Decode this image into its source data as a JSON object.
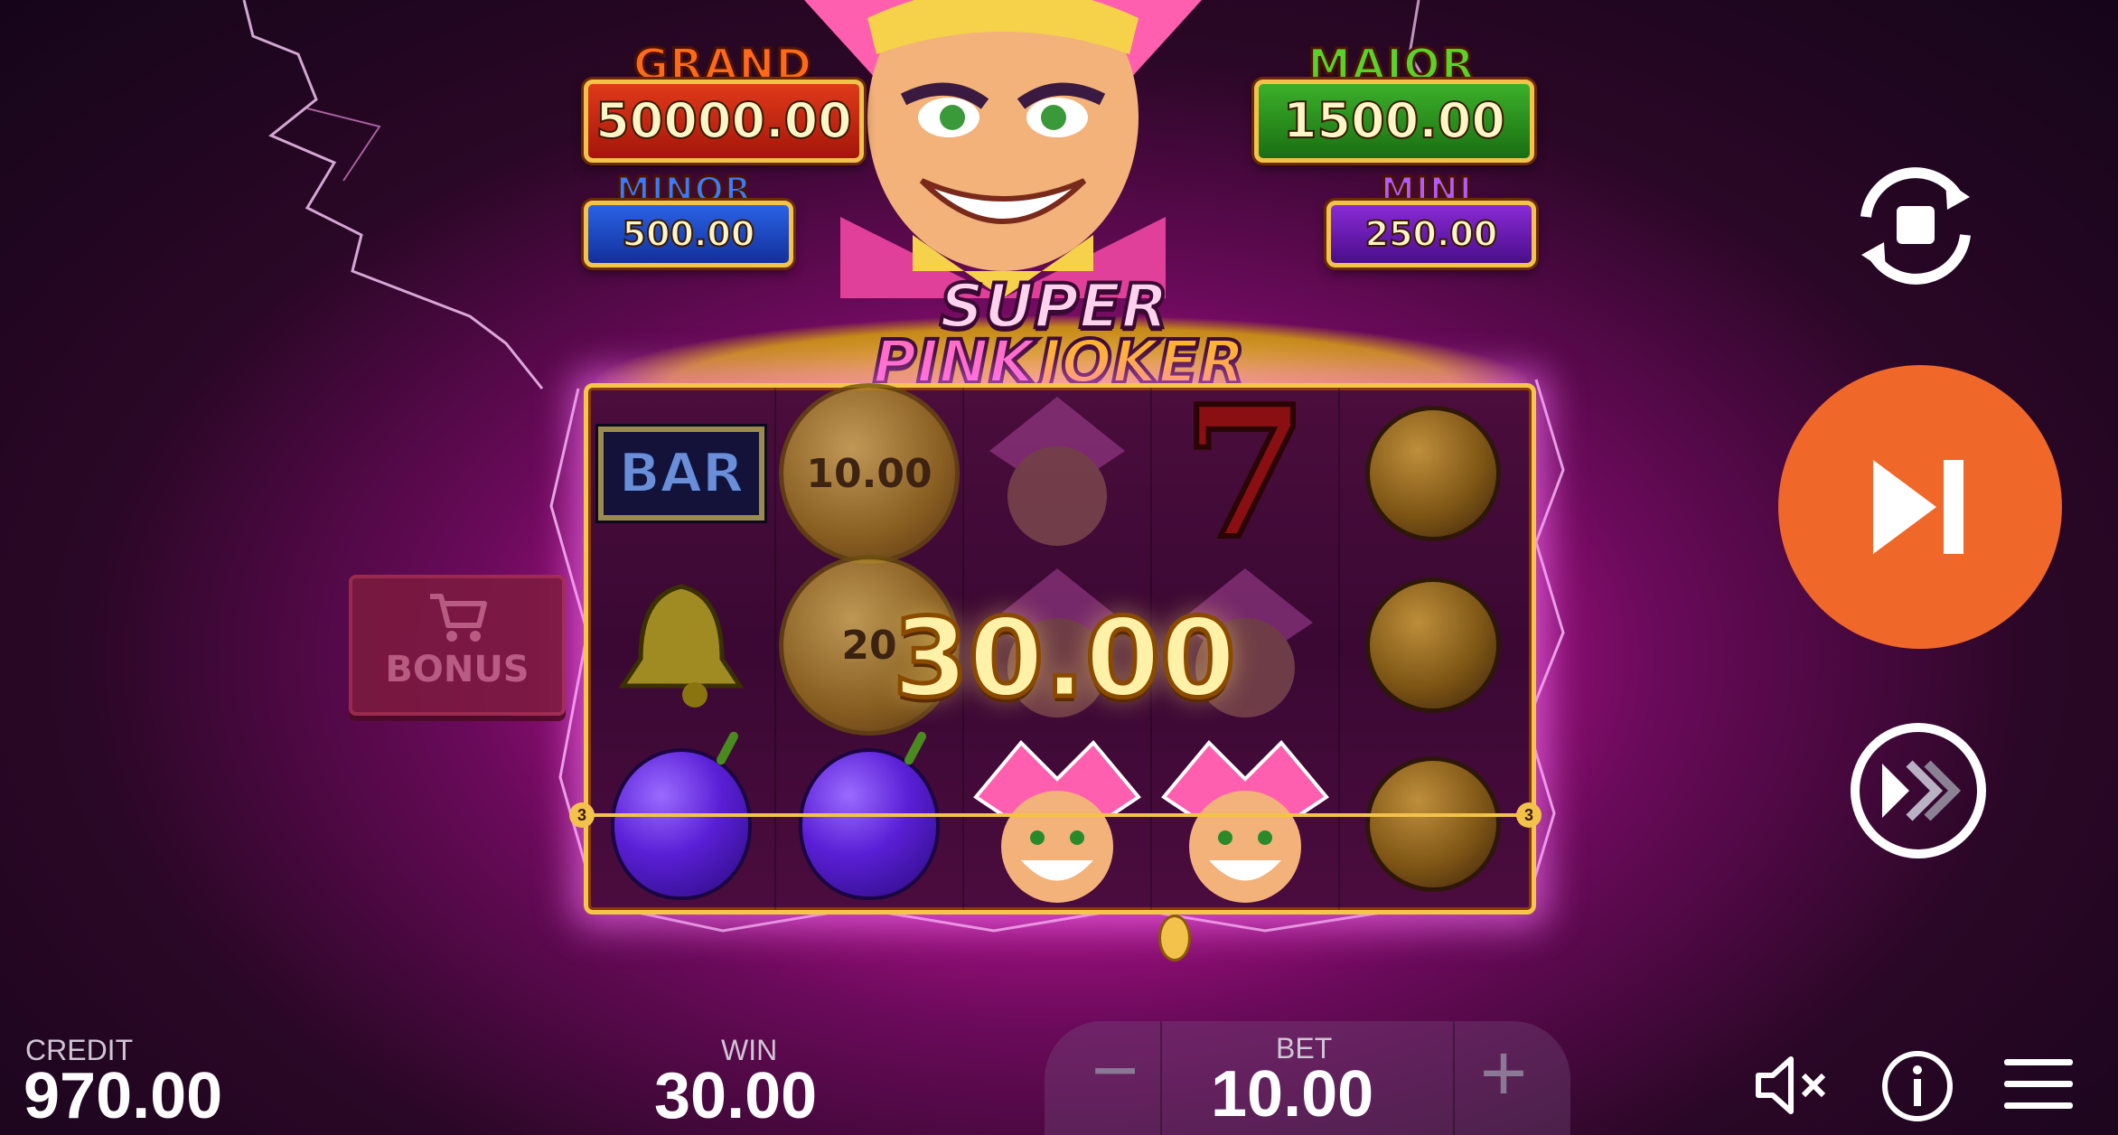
{
  "game": {
    "logo_line1": "SUPER",
    "logo_line2a": "PINK",
    "logo_line2b": "JOKER"
  },
  "jackpots": {
    "grand": {
      "label": "GRAND",
      "value": "50000.00"
    },
    "major": {
      "label": "MAJOR",
      "value": "1500.00"
    },
    "minor": {
      "label": "MINOR",
      "value": "500.00"
    },
    "mini": {
      "label": "MINI",
      "value": "250.00"
    }
  },
  "reels": {
    "coin_values": [
      "10.00",
      "20"
    ],
    "bar_label": "BAR",
    "seven_label": "7",
    "payline_number": "3",
    "win_overlay": "30.00"
  },
  "bonus": {
    "label": "BONUS"
  },
  "controls": {
    "autoplay_icon": "autoplay-icon",
    "spin_icon": "play-skip-icon",
    "turbo_icon": "fast-forward-icon",
    "accent": "#f0672a"
  },
  "status": {
    "credit_label": "CREDIT",
    "credit_value": "970.00",
    "win_label": "WIN",
    "win_value": "30.00",
    "bet_label": "BET",
    "bet_value": "10.00",
    "bet_minus": "−",
    "bet_plus": "+"
  },
  "menu_icons": [
    "sound-off-icon",
    "info-icon",
    "menu-icon"
  ]
}
